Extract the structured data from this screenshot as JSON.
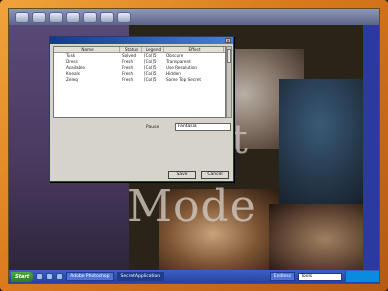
{
  "dialog": {
    "title": "",
    "columns": [
      "Name",
      "Status",
      "Legend",
      "Effect"
    ],
    "rows": [
      {
        "name": "Tusk",
        "status": "Solved",
        "legend": "[Col]5",
        "effect": "Obscure"
      },
      {
        "name": "Dress",
        "status": "Fresh",
        "legend": "[Col]5",
        "effect": "Transparent"
      },
      {
        "name": "Available",
        "status": "Fresh",
        "legend": "[Col]5",
        "effect": "Use Resolution"
      },
      {
        "name": "Kneals",
        "status": "Fresh",
        "legend": "[Col]5",
        "effect": "Hidden"
      },
      {
        "name": "Zeleq",
        "status": "Fresh",
        "legend": "[Col]5",
        "effect": "Some Top Secret"
      }
    ],
    "field_label": "Pause",
    "field_value": "Fantasia",
    "save_label": "Save",
    "cancel_label": "Cancel"
  },
  "desktop": {
    "word_top": "it",
    "word_bottom": "Mode"
  },
  "taskbar": {
    "start_label": "Start",
    "tasks": [
      "Adobe Photoshop",
      "SecretApplication"
    ],
    "tray_label": "Endless",
    "tray_field": "Tools"
  },
  "colors": {
    "frame": "#d9781c",
    "titlebar": "#123a8c",
    "taskbar": "#2443a0",
    "start": "#2f7d22"
  }
}
